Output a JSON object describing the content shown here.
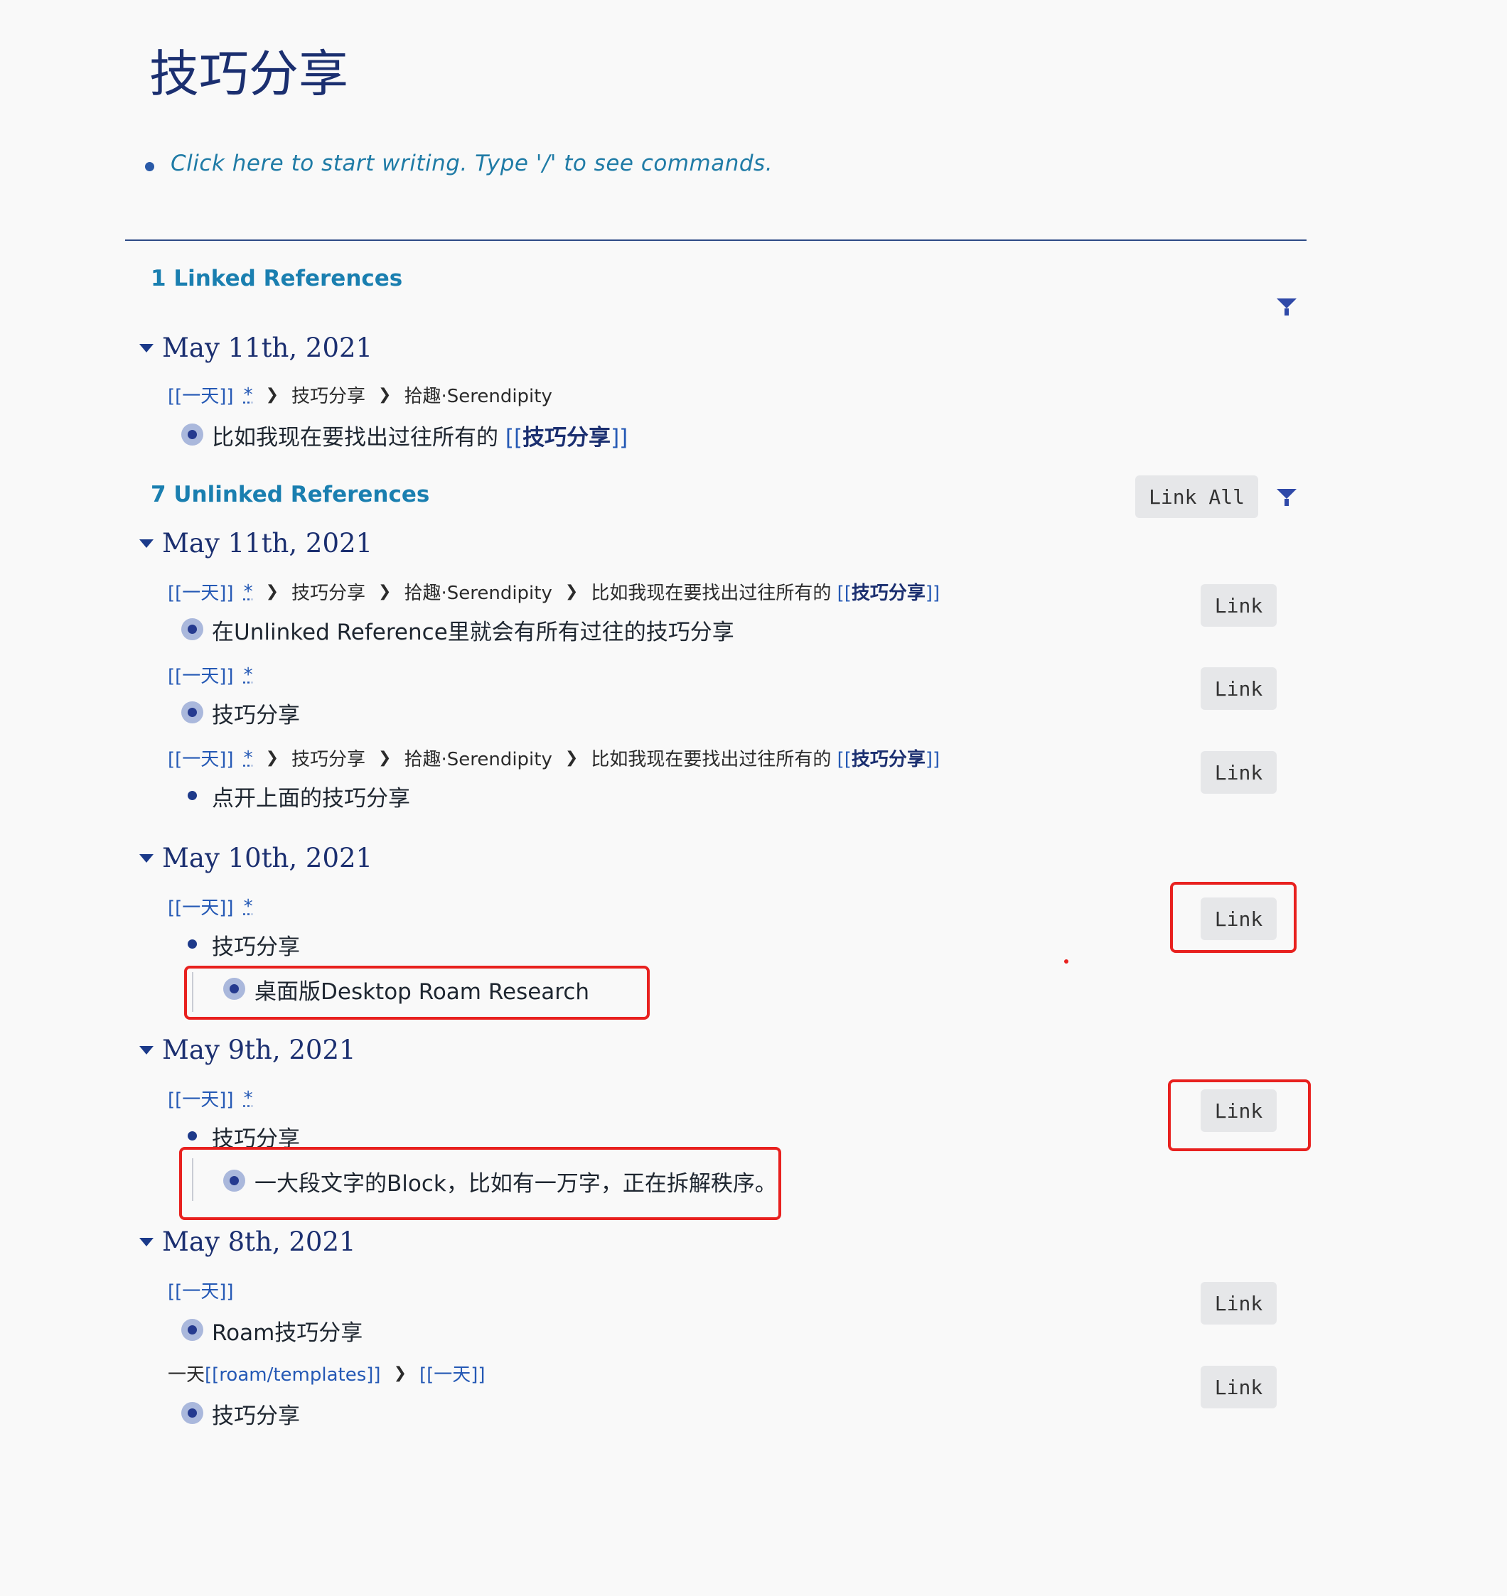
{
  "page": {
    "title": "技巧分享",
    "placeholder": "Click here to start writing. Type '/' to see commands."
  },
  "linked": {
    "heading": "1 Linked References",
    "groups": [
      {
        "date": "May 11th, 2021",
        "crumbs": {
          "day": "[[一天]]",
          "ast": "*",
          "c1": "技巧分享",
          "c2": "拾趣·Serendipity"
        },
        "block": {
          "text": "比如我现在要找出过往所有的 ",
          "ref_open": "[[",
          "ref_name": "技巧分享",
          "ref_close": "]]"
        }
      }
    ]
  },
  "unlinked": {
    "heading": "7 Unlinked References",
    "link_all_label": "Link All",
    "link_label": "Link",
    "g1": {
      "date": "May 11th, 2021",
      "r1": {
        "day": "[[一天]]",
        "ast": "*",
        "c1": "技巧分享",
        "c2": "拾趣·Serendipity",
        "c3": "比如我现在要找出过往所有的 ",
        "c3_ref_open": "[[",
        "c3_ref_name": "技巧分享",
        "c3_ref_close": "]]",
        "text": "在Unlinked Reference里就会有所有过往的技巧分享"
      },
      "r2": {
        "day": "[[一天]]",
        "ast": "*",
        "text": "技巧分享"
      },
      "r3": {
        "day": "[[一天]]",
        "ast": "*",
        "c1": "技巧分享",
        "c2": "拾趣·Serendipity",
        "c3": "比如我现在要找出过往所有的 ",
        "c3_ref_open": "[[",
        "c3_ref_name": "技巧分享",
        "c3_ref_close": "]]",
        "text": "点开上面的技巧分享"
      }
    },
    "g2": {
      "date": "May 10th, 2021",
      "r1": {
        "day": "[[一天]]",
        "ast": "*",
        "parent": "技巧分享",
        "child": "桌面版Desktop Roam Research"
      }
    },
    "g3": {
      "date": "May 9th, 2021",
      "r1": {
        "day": "[[一天]]",
        "ast": "*",
        "parent": "技巧分享",
        "child": "一大段文字的Block，比如有一万字，正在拆解秩序。"
      }
    },
    "g4": {
      "date": "May 8th, 2021",
      "r1": {
        "day": "[[一天]]",
        "text": "Roam技巧分享"
      },
      "r2": {
        "prefix": "一天",
        "tpl": "[[roam/templates]]",
        "day": "[[一天]]",
        "text": "技巧分享"
      }
    }
  },
  "colors": {
    "title": "#1b2f70",
    "section_heading": "#1a7fb0",
    "link": "#2559b5",
    "annotation_box": "#e8211f"
  }
}
